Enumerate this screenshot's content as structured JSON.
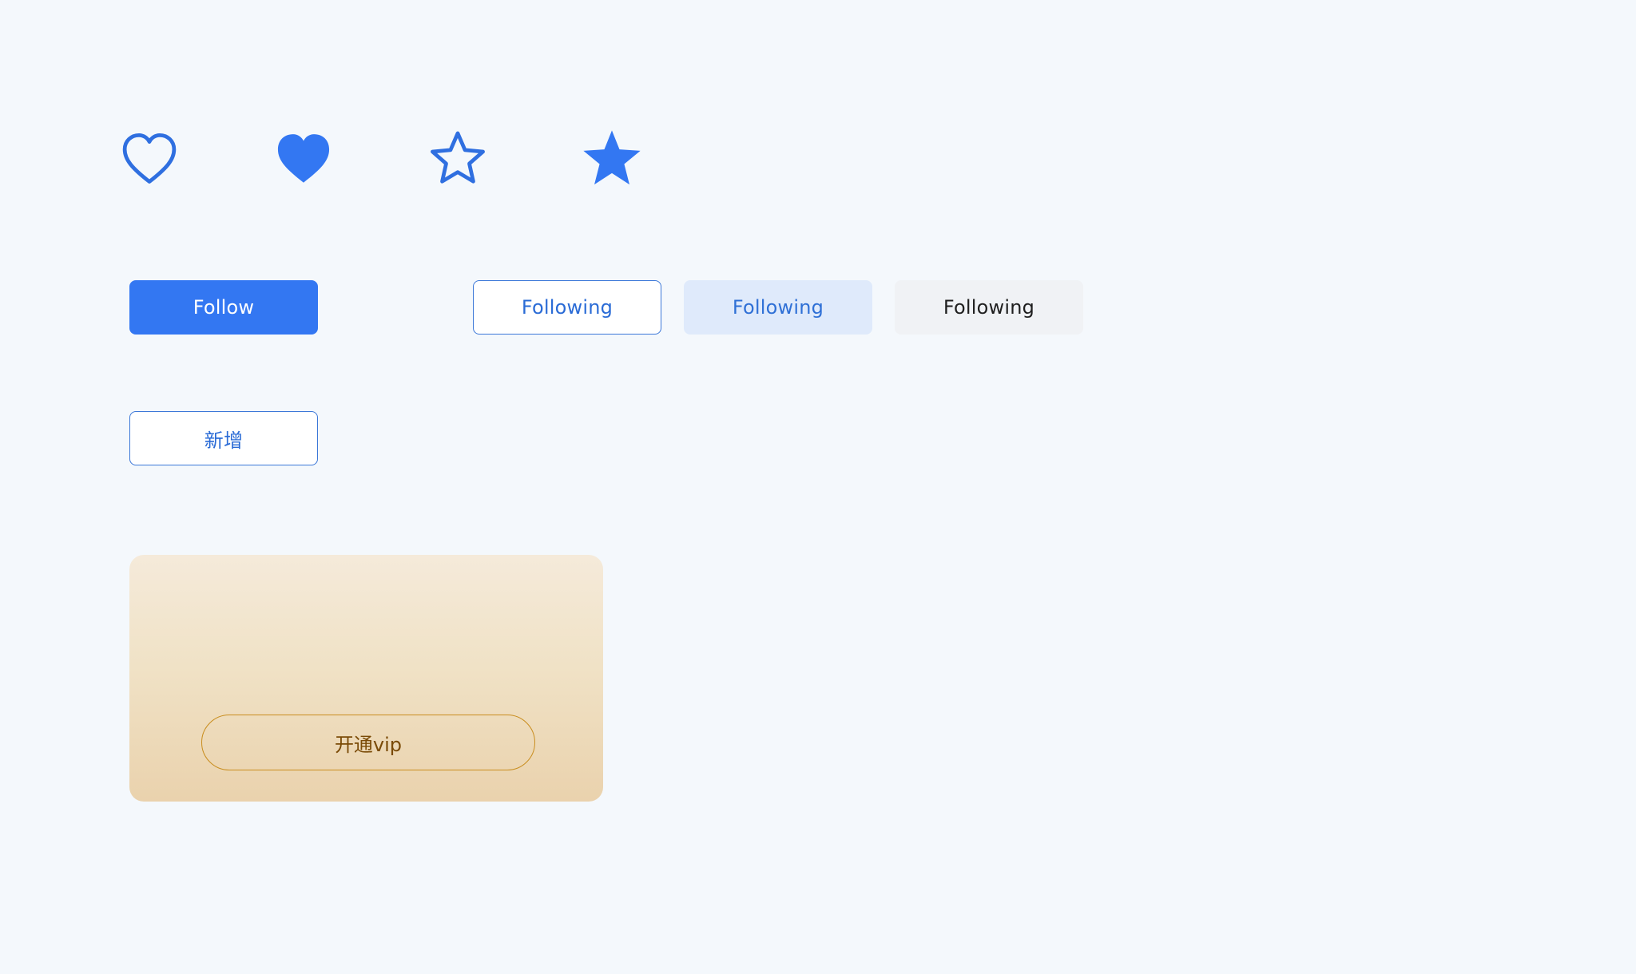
{
  "icons": [
    {
      "name": "heart-outline-icon",
      "color": "#2f6fe0"
    },
    {
      "name": "heart-filled-icon",
      "color": "#3377f2"
    },
    {
      "name": "star-outline-icon",
      "color": "#2f6fe0"
    },
    {
      "name": "star-filled-icon",
      "color": "#3377f2"
    }
  ],
  "buttons": {
    "follow": "Follow",
    "following_outline": "Following",
    "following_tint": "Following",
    "following_grey": "Following",
    "add": "新增"
  },
  "vip_card": {
    "button_label": "开通vip",
    "accent_color": "#c98d1e"
  },
  "colors": {
    "background": "#f4f8fc",
    "primary": "#3377f2"
  }
}
